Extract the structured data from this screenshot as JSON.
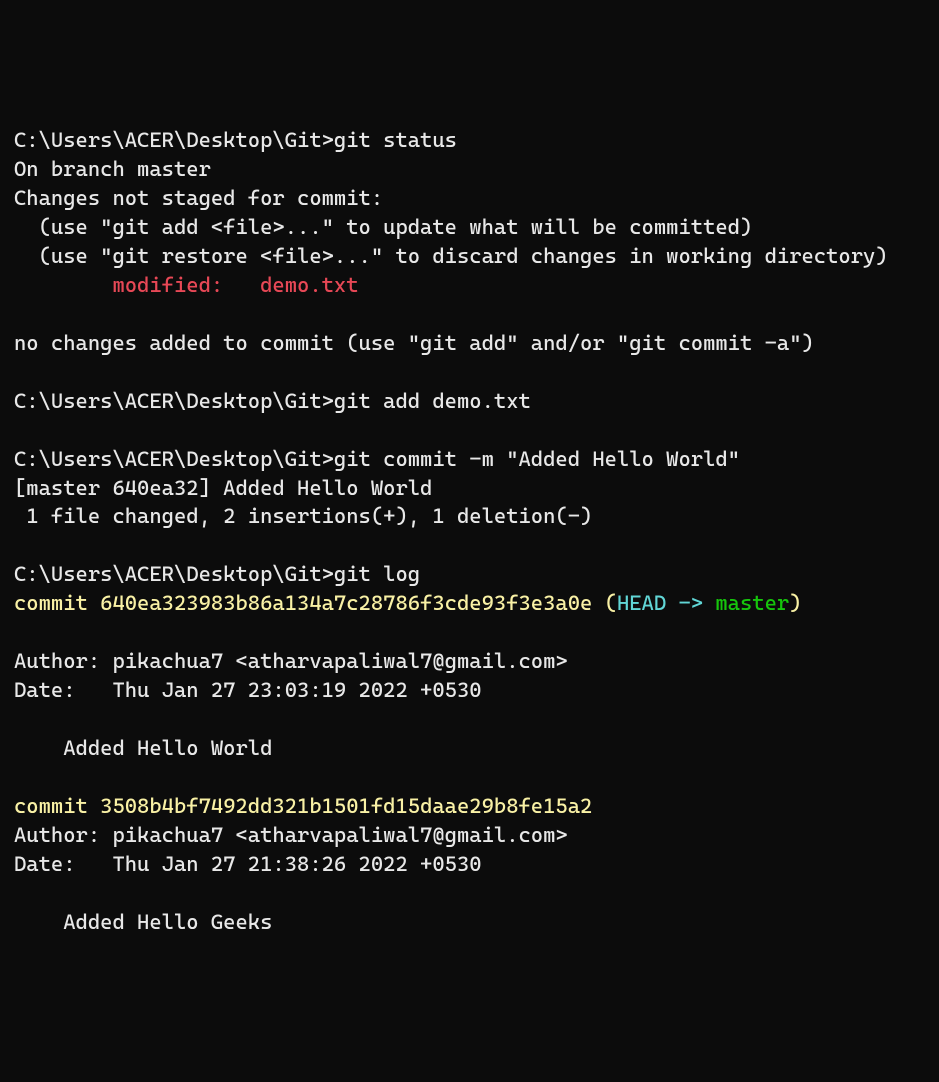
{
  "prompt": "C:\\Users\\ACER\\Desktop\\Git>",
  "cmd": {
    "status": "git status",
    "add": "git add demo.txt",
    "commit": "git commit -m \"Added Hello World\"",
    "log": "git log"
  },
  "status": {
    "branch": "On branch master",
    "hdr": "Changes not staged for commit:",
    "hint1": "  (use \"git add <file>...\" to update what will be committed)",
    "hint2": "  (use \"git restore <file>...\" to discard changes in working directory)",
    "mod_label": "        modified:   ",
    "mod_file": "demo.txt",
    "tail": "no changes added to commit (use \"git add\" and/or \"git commit -a\")"
  },
  "commit_out": {
    "l1": "[master 640ea32] Added Hello World",
    "l2": " 1 file changed, 2 insertions(+), 1 deletion(-)"
  },
  "log": {
    "c1": {
      "word": "commit ",
      "hash": "640ea323983b86a134a7c28786f3cde93f3e3a0e",
      "p_open": " (",
      "head": "HEAD -> ",
      "branch": "master",
      "p_close": ")",
      "author": "Author: pikachua7 <atharvapaliwal7@gmail.com>",
      "date": "Date:   Thu Jan 27 23:03:19 2022 +0530",
      "msg": "    Added Hello World"
    },
    "c2": {
      "word": "commit ",
      "hash": "3508b4bf7492dd321b1501fd15daae29b8fe15a2",
      "author": "Author: pikachua7 <atharvapaliwal7@gmail.com>",
      "date": "Date:   Thu Jan 27 21:38:26 2022 +0530",
      "msg": "    Added Hello Geeks"
    }
  }
}
